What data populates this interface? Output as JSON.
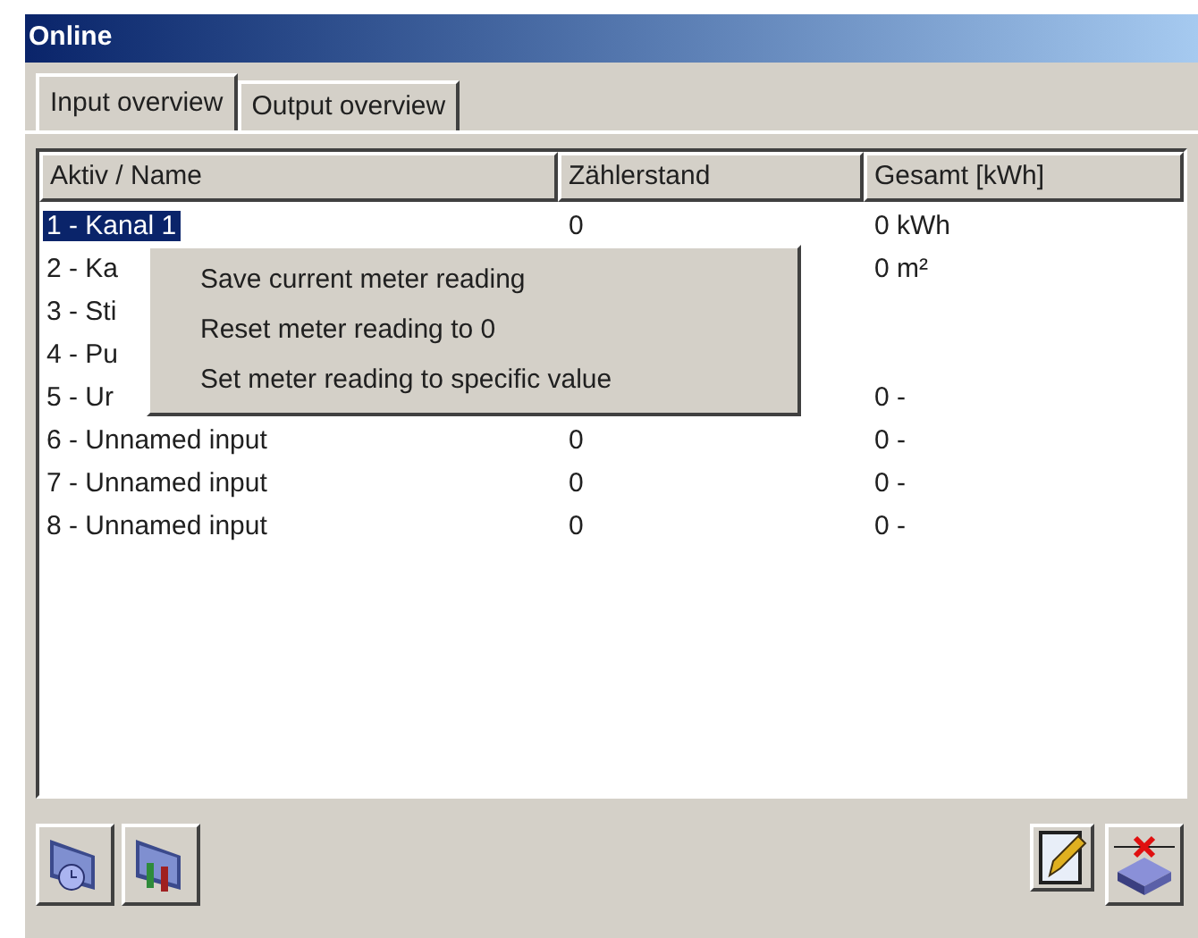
{
  "window": {
    "title": "Online"
  },
  "tabs": [
    {
      "label": "Input overview",
      "selected": true
    },
    {
      "label": "Output overview",
      "selected": false
    }
  ],
  "table": {
    "columns": [
      "Aktiv / Name",
      "Zählerstand",
      "Gesamt [kWh]"
    ],
    "rows": [
      {
        "name": "1 - Kanal 1",
        "reading": "0",
        "total": "0 kWh",
        "selected": true
      },
      {
        "name": "2 - Ka",
        "total": "0 m²",
        "selected": false
      },
      {
        "name": "3 - Sti",
        "selected": false
      },
      {
        "name": "4 - Pu",
        "selected": false
      },
      {
        "name": "5 - Ur",
        "total": "0 -",
        "selected": false
      },
      {
        "name": "6 - Unnamed input",
        "reading": "0",
        "total": "0 -",
        "selected": false
      },
      {
        "name": "7 - Unnamed input",
        "reading": "0",
        "total": "0 -",
        "selected": false
      },
      {
        "name": "8 - Unnamed input",
        "reading": "0",
        "total": "0 -",
        "selected": false
      }
    ]
  },
  "context_menu": {
    "items": [
      "Save current meter reading",
      "Reset meter reading to 0",
      "Set meter reading to specific value"
    ]
  },
  "toolbar": {
    "left": [
      {
        "kind": "clock"
      },
      {
        "kind": "io"
      }
    ],
    "right": [
      {
        "kind": "edit"
      },
      {
        "kind": "delete"
      }
    ]
  }
}
